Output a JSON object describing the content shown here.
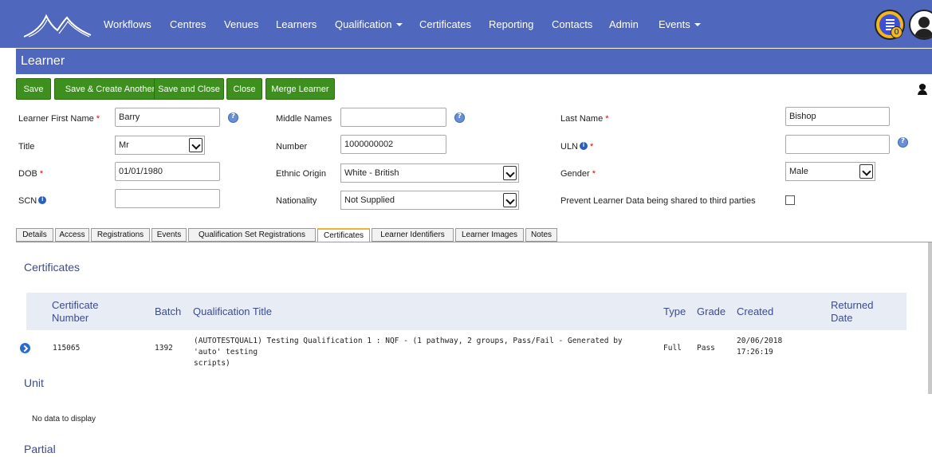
{
  "nav": {
    "items": [
      "Workflows",
      "Centres",
      "Venues",
      "Learners",
      "Qualification",
      "Certificates",
      "Reporting",
      "Contacts",
      "Admin",
      "Events"
    ],
    "tasks_badge": "0",
    "colors": {
      "bar": "#4f67bd",
      "accent": "#f3b61f"
    }
  },
  "page": {
    "title": "Learner"
  },
  "toolbar": {
    "save": "Save",
    "save_create": "Save & Create Another",
    "save_close": "Save and Close",
    "close": "Close",
    "merge": "Merge Learner",
    "button_color": "#3d8f1e"
  },
  "form": {
    "first_name_label": "Learner First Name",
    "first_name": "Barry",
    "middle_names_label": "Middle Names",
    "middle_names": "",
    "last_name_label": "Last Name",
    "last_name": "Bishop",
    "title_label": "Title",
    "title": "Mr",
    "number_label": "Number",
    "number": "1000000002",
    "uln_label": "ULN",
    "uln": "",
    "dob_label": "DOB",
    "dob": "01/01/1980",
    "ethnic_label": "Ethnic Origin",
    "ethnic": "White - British",
    "gender_label": "Gender",
    "gender": "Male",
    "scn_label": "SCN",
    "scn": "",
    "nationality_label": "Nationality",
    "nationality": "Not Supplied",
    "prevent_label": "Prevent Learner Data being shared to third parties",
    "prevent_checked": false
  },
  "tabs": [
    "Details",
    "Access",
    "Registrations",
    "Events",
    "Qualification Set Registrations",
    "Certificates",
    "Learner Identifiers",
    "Learner Images",
    "Notes"
  ],
  "active_tab": "Certificates",
  "certificates": {
    "heading": "Certificates",
    "columns": {
      "number_line1": "Certificate",
      "number_line2": "Number",
      "batch": "Batch",
      "qual": "Qualification Title",
      "type": "Type",
      "grade": "Grade",
      "created": "Created",
      "returned_line1": "Returned",
      "returned_line2": "Date"
    },
    "rows": [
      {
        "number": "115065",
        "batch": "1392",
        "qual_line1": "(AUTOTESTQUAL1) Testing Qualification 1 : NQF - (1 pathway, 2 groups, Pass/Fail - Generated by 'auto' testing",
        "qual_line2": "scripts)",
        "type": "Full",
        "grade": "Pass",
        "created_line1": "20/06/2018",
        "created_line2": "17:26:19",
        "returned": ""
      }
    ]
  },
  "unit": {
    "heading": "Unit",
    "empty": "No data to display"
  },
  "partial": {
    "heading": "Partial"
  }
}
